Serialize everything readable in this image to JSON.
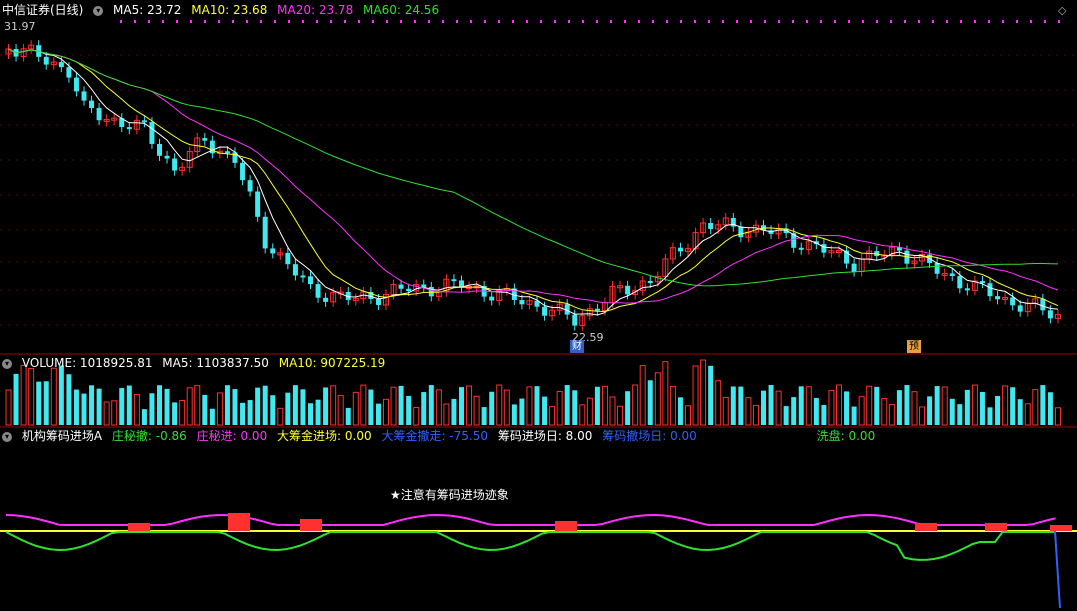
{
  "title": {
    "stock": "中信证券(日线)",
    "ma5": "MA5: 23.72",
    "ma10": "MA10: 23.68",
    "ma20": "MA20: 23.78",
    "ma60": "MA60: 24.56"
  },
  "price": {
    "high_label": "31.97",
    "low_label": "22.59",
    "tag_cai": "财",
    "tag_yu": "预"
  },
  "volume": {
    "volume": "VOLUME: 1018925.81",
    "ma5": "MA5: 1103837.50",
    "ma10": "MA10: 907225.19"
  },
  "indicator": {
    "name": "机构筹码进场A",
    "zhuang_che": "庄秘撤: -0.86",
    "zhuang_jin": "庄秘进: 0.00",
    "da_jin": "大筹金进场: 0.00",
    "da_chu": "大筹金撤走: -75.50",
    "chouma_ri": "筹码进场日: 8.00",
    "chouma_chu": "筹码撤场日: 0.00",
    "xipan": "洗盘: 0.00",
    "notice": "★注意有筹码进场迹象"
  },
  "colors": {
    "up": "#ff3030",
    "down": "#40e8f0",
    "ma5": "#ffffff",
    "ma10": "#ffff30",
    "ma20": "#ff30ff",
    "ma60": "#30e030"
  }
}
